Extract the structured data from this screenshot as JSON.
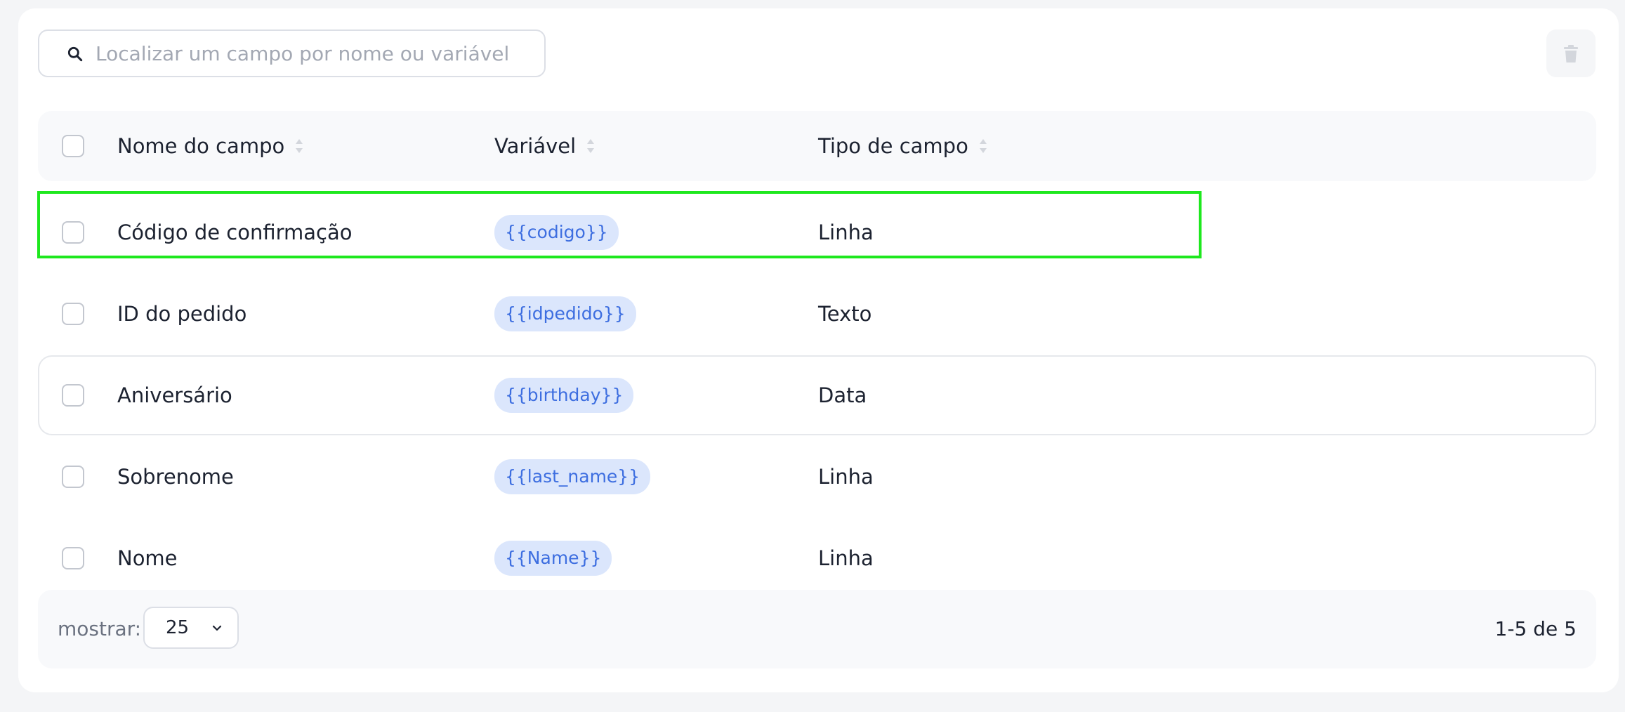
{
  "search": {
    "placeholder": "Localizar um campo por nome ou variável",
    "icon": "search-icon"
  },
  "toolbar": {
    "delete_icon": "trash-icon"
  },
  "table": {
    "columns": [
      "Nome do campo",
      "Variável",
      "Tipo de campo"
    ],
    "rows": [
      {
        "name": "Código de confirmação",
        "variable": "{{codigo}}",
        "type": "Linha"
      },
      {
        "name": "ID do pedido",
        "variable": "{{idpedido}}",
        "type": "Texto"
      },
      {
        "name": "Aniversário",
        "variable": "{{birthday}}",
        "type": "Data"
      },
      {
        "name": "Sobrenome",
        "variable": "{{last_name}}",
        "type": "Linha"
      },
      {
        "name": "Nome",
        "variable": "{{Name}}",
        "type": "Linha"
      }
    ]
  },
  "footer": {
    "show_label": "mostrar:",
    "page_size": "25",
    "range": "1-5 de 5"
  },
  "colors": {
    "tag_bg": "#dbe6fc",
    "tag_text": "#3d6ee0",
    "highlight": "#1ee81e"
  }
}
